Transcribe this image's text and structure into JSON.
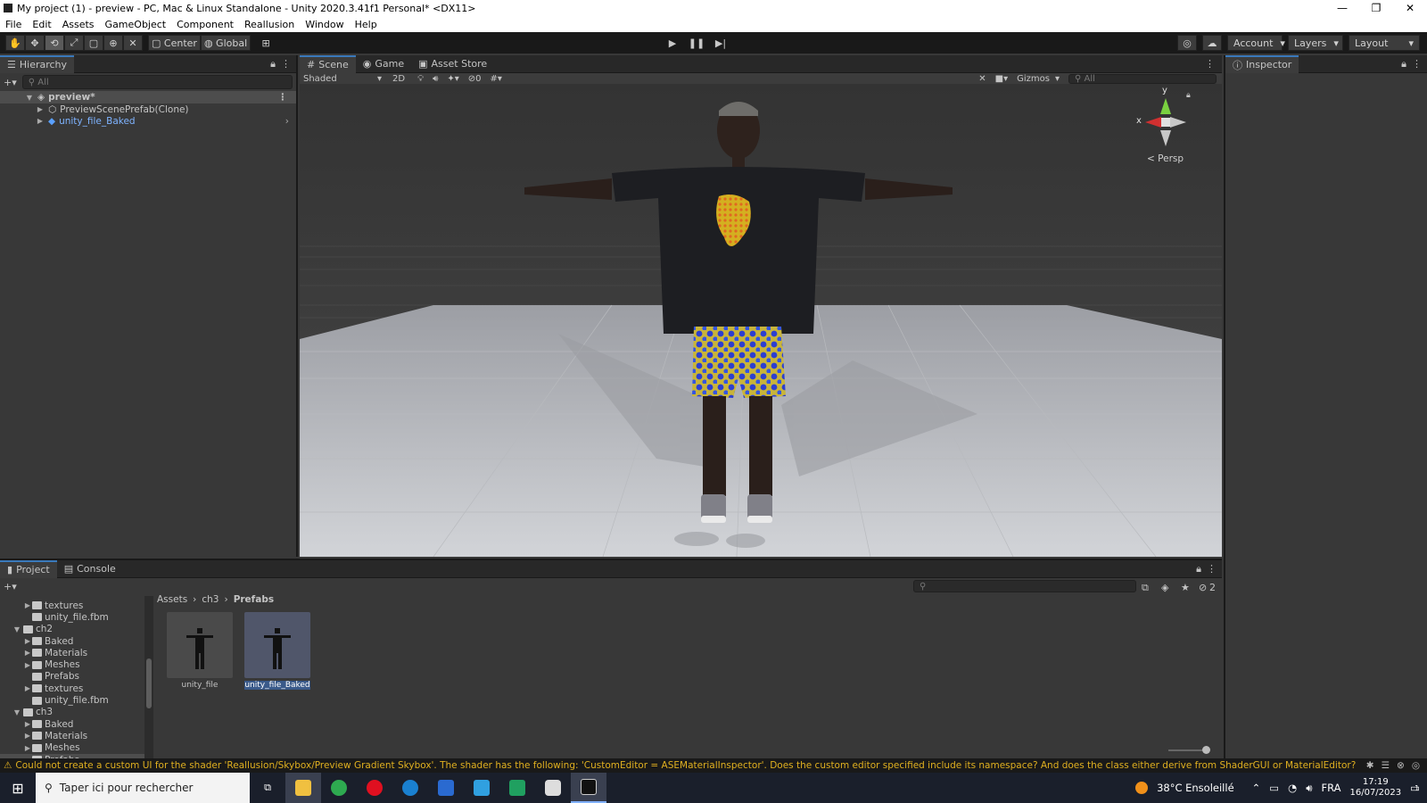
{
  "window": {
    "title": "My project (1) - preview - PC, Mac & Linux Standalone - Unity 2020.3.41f1 Personal* <DX11>"
  },
  "menu": [
    "File",
    "Edit",
    "Assets",
    "GameObject",
    "Component",
    "Reallusion",
    "Window",
    "Help"
  ],
  "toolbar": {
    "pivot": "Center",
    "space": "Global",
    "account": "Account",
    "layers": "Layers",
    "layout": "Layout"
  },
  "hierarchy": {
    "tab": "Hierarchy",
    "search_placeholder": "All",
    "root": "preview*",
    "items": [
      "PreviewScenePrefab(Clone)",
      "unity_file_Baked"
    ]
  },
  "scene": {
    "tabs": [
      "Scene",
      "Game",
      "Asset Store"
    ],
    "shading": "Shaded",
    "mode_2d": "2D",
    "hidden_count": "0",
    "gizmos": "Gizmos",
    "search_placeholder": "All",
    "gizmo_y": "y",
    "gizmo_x": "x",
    "projection": "Persp"
  },
  "inspector": {
    "tab": "Inspector"
  },
  "project": {
    "tabs": [
      "Project",
      "Console"
    ],
    "hidden_count": "2",
    "tree": [
      {
        "label": "textures",
        "level": 2,
        "arrow": true
      },
      {
        "label": "unity_file.fbm",
        "level": 2,
        "arrow": false
      },
      {
        "label": "ch2",
        "level": 1,
        "arrow": true,
        "open": true
      },
      {
        "label": "Baked",
        "level": 2,
        "arrow": true
      },
      {
        "label": "Materials",
        "level": 2,
        "arrow": true
      },
      {
        "label": "Meshes",
        "level": 2,
        "arrow": true
      },
      {
        "label": "Prefabs",
        "level": 2,
        "arrow": false
      },
      {
        "label": "textures",
        "level": 2,
        "arrow": true
      },
      {
        "label": "unity_file.fbm",
        "level": 2,
        "arrow": false
      },
      {
        "label": "ch3",
        "level": 1,
        "arrow": true,
        "open": true
      },
      {
        "label": "Baked",
        "level": 2,
        "arrow": true
      },
      {
        "label": "Materials",
        "level": 2,
        "arrow": true
      },
      {
        "label": "Meshes",
        "level": 2,
        "arrow": true
      },
      {
        "label": "Prefabs",
        "level": 2,
        "arrow": false,
        "selected": true
      }
    ],
    "breadcrumb": [
      "Assets",
      "ch3",
      "Prefabs"
    ],
    "assets": [
      "unity_file",
      "unity_file_Baked"
    ]
  },
  "status": {
    "message": "Could not create a custom UI for the shader 'Reallusion/Skybox/Preview Gradient Skybox'. The shader has the following: 'CustomEditor = ASEMaterialInspector'. Does the custom editor specified include its namespace? And does the class either derive from ShaderGUI or MaterialEditor?"
  },
  "taskbar": {
    "search_placeholder": "Taper ici pour rechercher",
    "weather": "38°C  Ensoleillé",
    "language": "FRA",
    "time": "17:19",
    "date": "16/07/2023",
    "notifications": "1"
  },
  "colors": {
    "accent": "#3a79bb",
    "warning": "#e0b020",
    "taskbar": "#1a1f2b"
  }
}
